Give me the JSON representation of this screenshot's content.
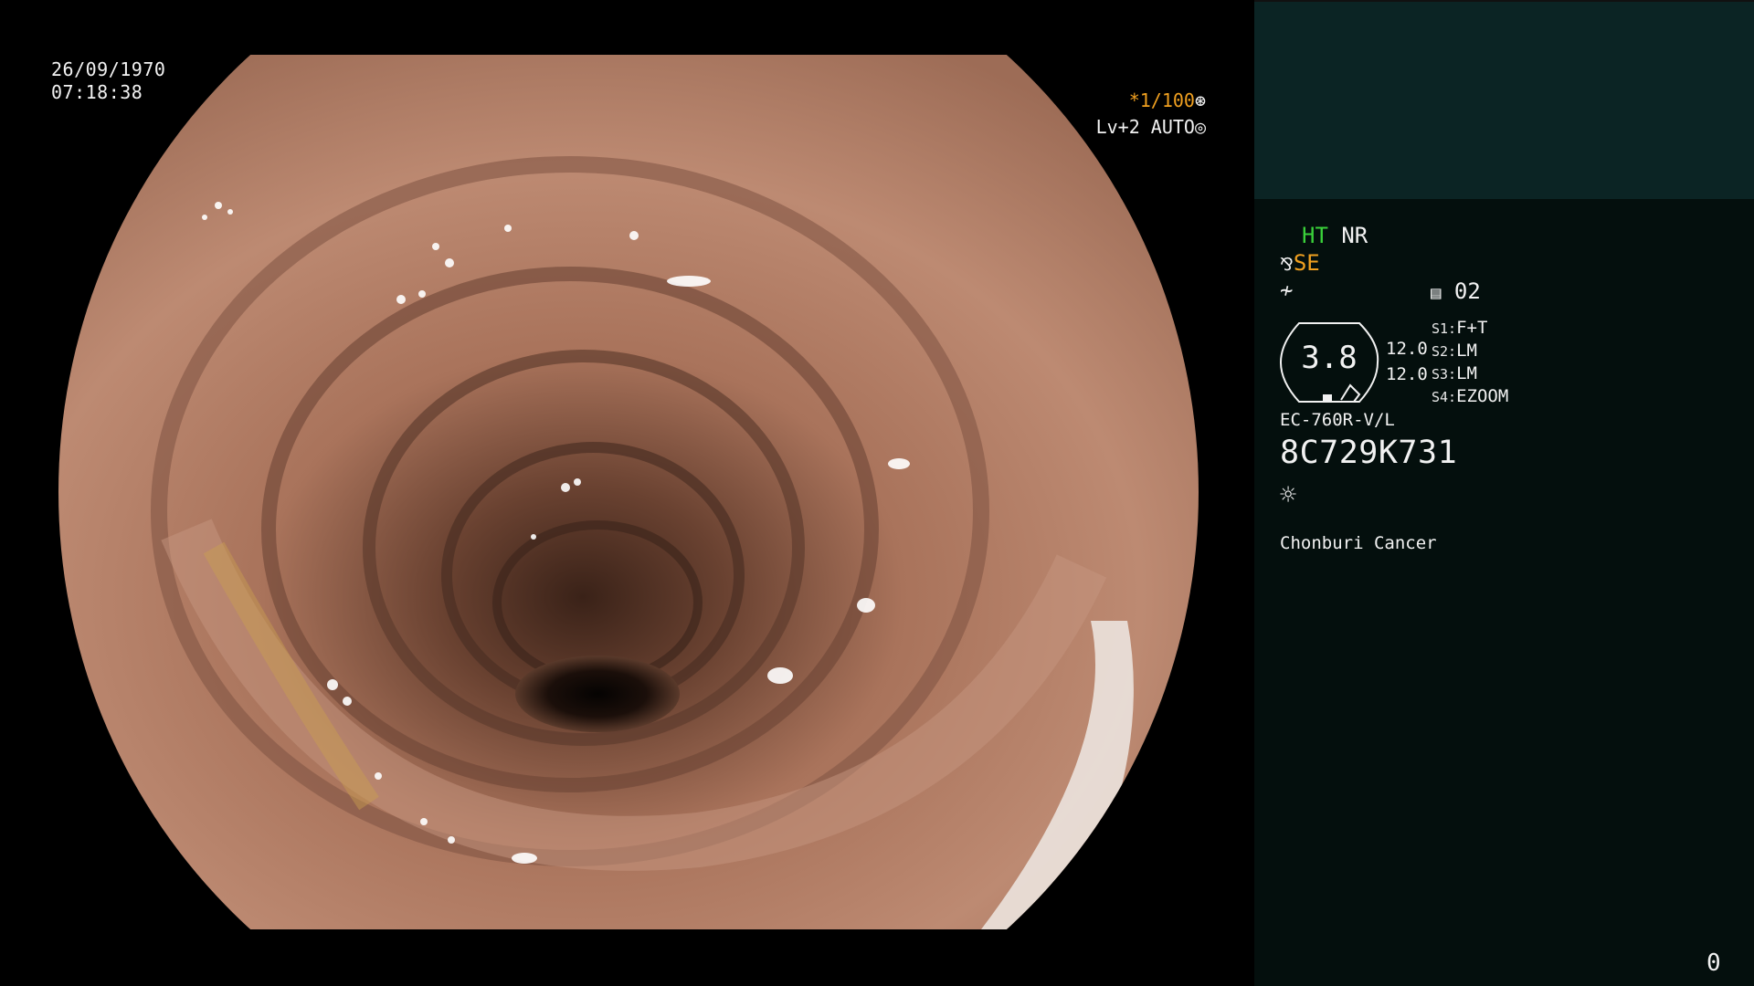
{
  "overlay": {
    "date": "26/09/1970",
    "time": "07:18:38",
    "shutter": "*1/100",
    "shutter_icon": "aperture-icon",
    "level": "Lv+2 AUTO",
    "level_icon": "iris-icon"
  },
  "panel": {
    "ht": "HT",
    "nr": "NR",
    "se": "SE",
    "memory_icon": "memory-card-icon",
    "memory_value": "02",
    "scope_value": "3.8",
    "dim_upper": "12.0",
    "dim_lower": "12.0",
    "switches": [
      {
        "key": "S1:",
        "value": "F+T"
      },
      {
        "key": "S2:",
        "value": "LM"
      },
      {
        "key": "S3:",
        "value": "LM"
      },
      {
        "key": "S4:",
        "value": "EZOOM"
      }
    ],
    "scope_model": "EC-760R-V/L",
    "serial": "8C729K731",
    "light_icon": "light-icon",
    "institution": "Chonburi Cancer",
    "counter": "0"
  },
  "colors": {
    "ht_green": "#3ad13a",
    "se_orange": "#f0a020",
    "panel_top": "#0b2424",
    "panel_bottom": "#040f0d",
    "mucosa": "#b98a72"
  }
}
